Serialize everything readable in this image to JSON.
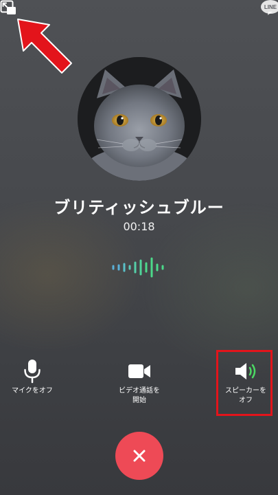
{
  "badge": {
    "text": "LINE"
  },
  "caller": {
    "name": "ブリティッシュブルー",
    "duration": "00:18"
  },
  "controls": {
    "mute_label": "マイクをオフ",
    "video_label": "ビデオ通話を\n開始",
    "speaker_label": "スピーカーを\nオフ"
  },
  "icons": {
    "minimize": "minimize-window-icon",
    "mic": "microphone-icon",
    "video": "video-camera-icon",
    "speaker": "speaker-icon",
    "end_call": "close-icon"
  },
  "colors": {
    "end_call": "#ee4a56",
    "speaker_active": "#4cd964",
    "annotation": "#e3141b",
    "waveform_blue": "#5ab0d8",
    "waveform_green": "#4cd98a"
  }
}
